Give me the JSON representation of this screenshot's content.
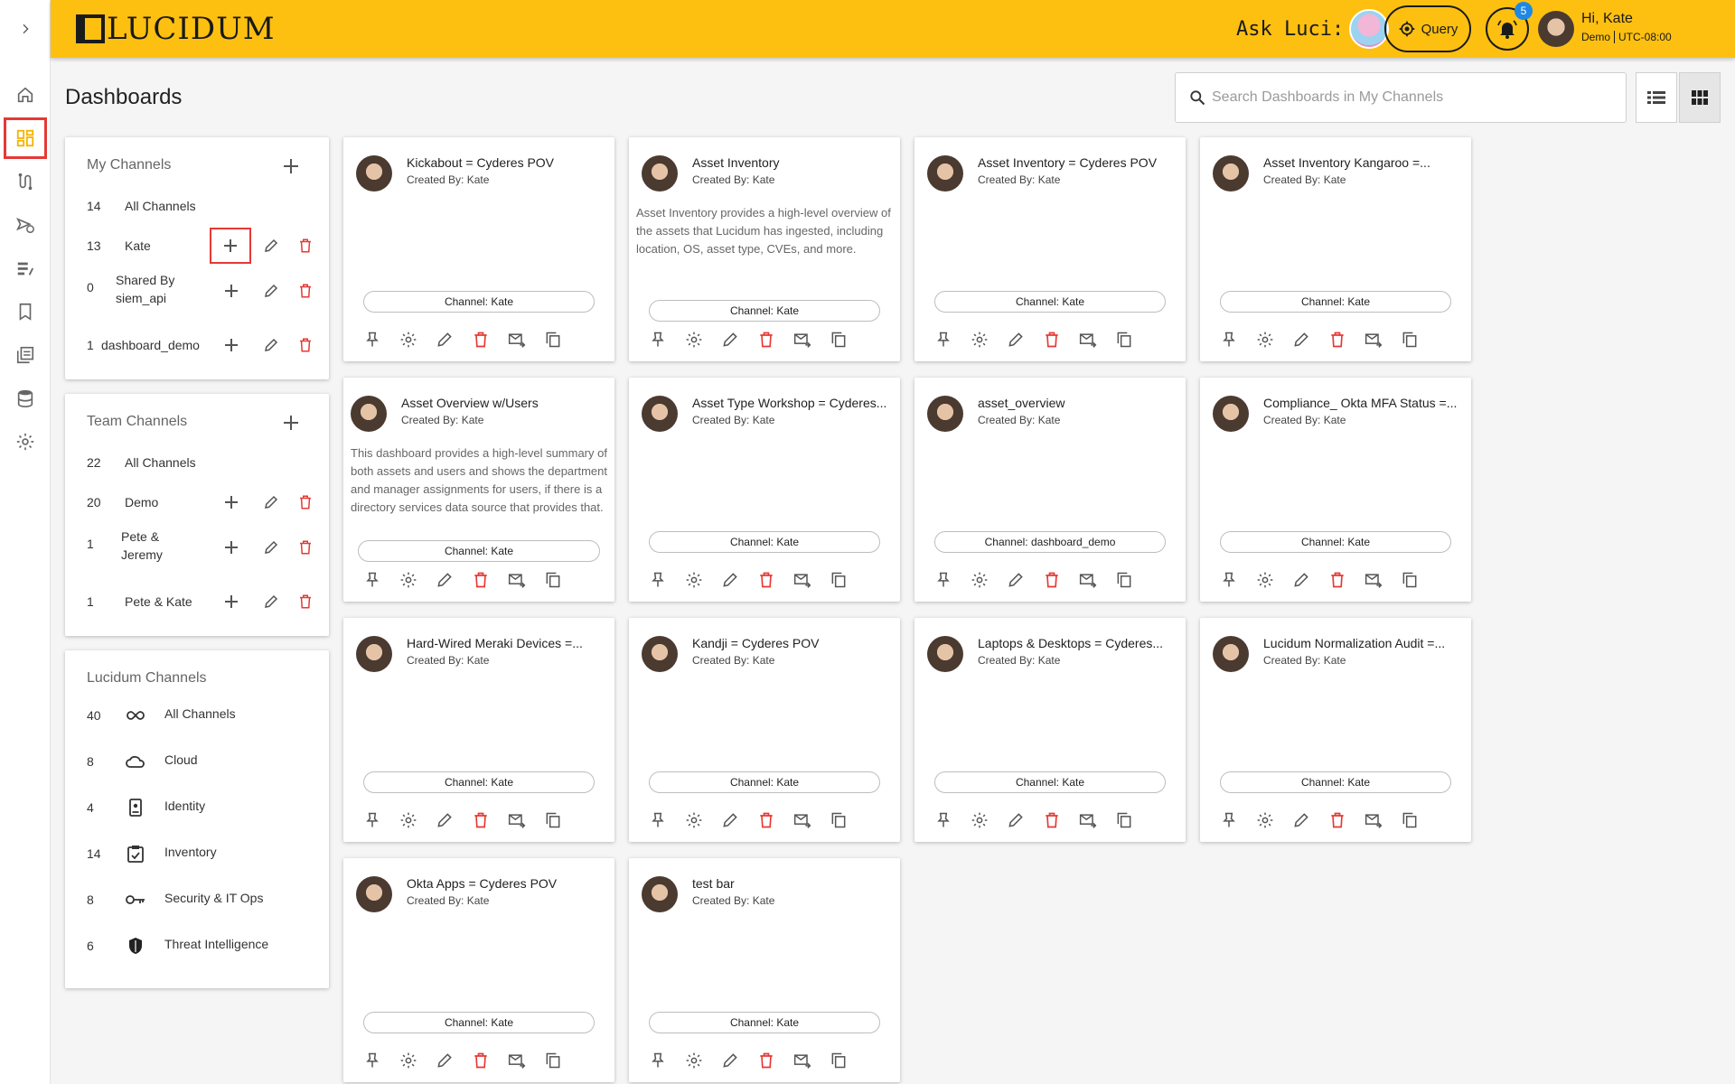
{
  "brand": {
    "logo_text": "LUCIDUM"
  },
  "topbar": {
    "ask_label": "Ask Luci:",
    "query_label": "Query",
    "notification_count": "5",
    "greeting": "Hi, Kate",
    "org": "Demo",
    "timezone": "UTC-08:00"
  },
  "page": {
    "title": "Dashboards",
    "search_placeholder": "Search Dashboards in My Channels"
  },
  "my_channels": {
    "title": "My Channels",
    "rows": [
      {
        "count": "14",
        "name": "All Channels"
      },
      {
        "count": "13",
        "name": "Kate"
      },
      {
        "count": "0",
        "name": "Shared By siem_api"
      },
      {
        "count": "1",
        "name": "dashboard_demo"
      }
    ]
  },
  "team_channels": {
    "title": "Team Channels",
    "rows": [
      {
        "count": "22",
        "name": "All Channels"
      },
      {
        "count": "20",
        "name": "Demo"
      },
      {
        "count": "1",
        "name": "Pete & Jeremy"
      },
      {
        "count": "1",
        "name": "Pete & Kate"
      }
    ]
  },
  "lucidum_channels": {
    "title": "Lucidum Channels",
    "rows": [
      {
        "count": "40",
        "name": "All Channels",
        "icon": "infinity-icon"
      },
      {
        "count": "8",
        "name": "Cloud",
        "icon": "cloud-icon"
      },
      {
        "count": "4",
        "name": "Identity",
        "icon": "id-badge-icon"
      },
      {
        "count": "14",
        "name": "Inventory",
        "icon": "clipboard-icon"
      },
      {
        "count": "8",
        "name": "Security & IT Ops",
        "icon": "key-icon"
      },
      {
        "count": "6",
        "name": "Threat Intelligence",
        "icon": "shield-icon"
      }
    ]
  },
  "dashboards": [
    {
      "title": "Kickabout = Cyderes POV",
      "created_by": "Created By: Kate",
      "description": "",
      "channel": "Channel: Kate"
    },
    {
      "title": "Asset Inventory",
      "created_by": "Created By: Kate",
      "description": "Asset Inventory provides a high-level overview of the assets that Lucidum has ingested, including location, OS, asset type, CVEs, and more.",
      "channel": "Channel: Kate"
    },
    {
      "title": "Asset Inventory = Cyderes POV",
      "created_by": "Created By: Kate",
      "description": "",
      "channel": "Channel: Kate"
    },
    {
      "title": "Asset Inventory Kangaroo =...",
      "created_by": "Created By: Kate",
      "description": "",
      "channel": "Channel: Kate"
    },
    {
      "title": "Asset Overview w/Users",
      "created_by": "Created By: Kate",
      "description": "This dashboard provides a high-level summary of both assets and users and shows the department and manager assignments for users, if there is a directory services data source that provides that.",
      "channel": "Channel: Kate"
    },
    {
      "title": "Asset Type Workshop = Cyderes...",
      "created_by": "Created By: Kate",
      "description": "",
      "channel": "Channel: Kate"
    },
    {
      "title": "asset_overview",
      "created_by": "Created By: Kate",
      "description": "",
      "channel": "Channel: dashboard_demo"
    },
    {
      "title": "Compliance_ Okta MFA Status =...",
      "created_by": "Created By: Kate",
      "description": "",
      "channel": "Channel: Kate"
    },
    {
      "title": "Hard-Wired Meraki Devices =...",
      "created_by": "Created By: Kate",
      "description": "",
      "channel": "Channel: Kate"
    },
    {
      "title": "Kandji = Cyderes POV",
      "created_by": "Created By: Kate",
      "description": "",
      "channel": "Channel: Kate"
    },
    {
      "title": "Laptops & Desktops = Cyderes...",
      "created_by": "Created By: Kate",
      "description": "",
      "channel": "Channel: Kate"
    },
    {
      "title": "Lucidum Normalization Audit =...",
      "created_by": "Created By: Kate",
      "description": "",
      "channel": "Channel: Kate"
    },
    {
      "title": "Okta Apps = Cyderes POV",
      "created_by": "Created By: Kate",
      "description": "",
      "channel": "Channel: Kate"
    },
    {
      "title": "test bar",
      "created_by": "Created By: Kate",
      "description": "",
      "channel": "Channel: Kate"
    }
  ],
  "colors": {
    "topbar": "#fdc010",
    "danger": "#e53935",
    "active_nav": "#f5b400",
    "badge": "#1e88e5"
  }
}
